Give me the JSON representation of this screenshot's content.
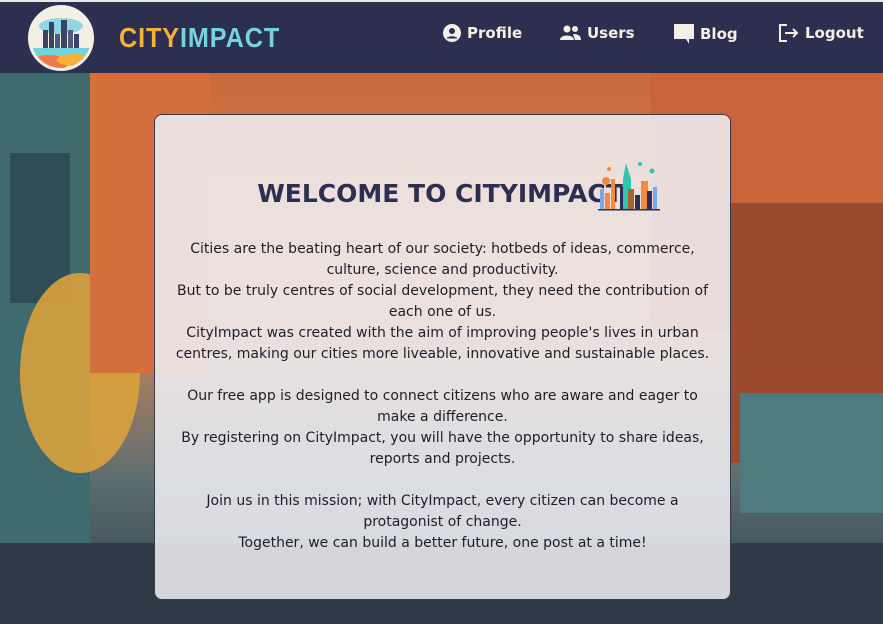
{
  "brand": {
    "part1": "CITY",
    "part2": "IMPACT"
  },
  "nav": [
    {
      "label": "Profile",
      "icon": "user-circle-icon"
    },
    {
      "label": "Users",
      "icon": "users-icon"
    },
    {
      "label": "Blog",
      "icon": "comment-icon"
    },
    {
      "label": "Logout",
      "icon": "logout-icon"
    }
  ],
  "card": {
    "title": "WELCOME TO CITYIMPACT",
    "paragraphs": [
      [
        "Cities are the beating heart of our society: hotbeds of ideas, commerce, culture, science and productivity.",
        "But to be truly centres of social development, they need the contribution of each one of us.",
        "CityImpact was created with the aim of improving people's lives in urban centres, making our cities more liveable, innovative and sustainable places."
      ],
      [
        "Our free app is designed to connect citizens who are aware and eager to make a difference.",
        "By registering on CityImpact, you will have the opportunity to share ideas, reports and projects."
      ],
      [
        "Join us in this mission; with CityImpact, every citizen can become a protagonist of change.",
        "Together, we can build a better future, one post at a time!"
      ]
    ]
  },
  "colors": {
    "navbar": "#2c2f4f",
    "brand_orange": "#f7b03a",
    "brand_teal": "#74d3e0"
  }
}
